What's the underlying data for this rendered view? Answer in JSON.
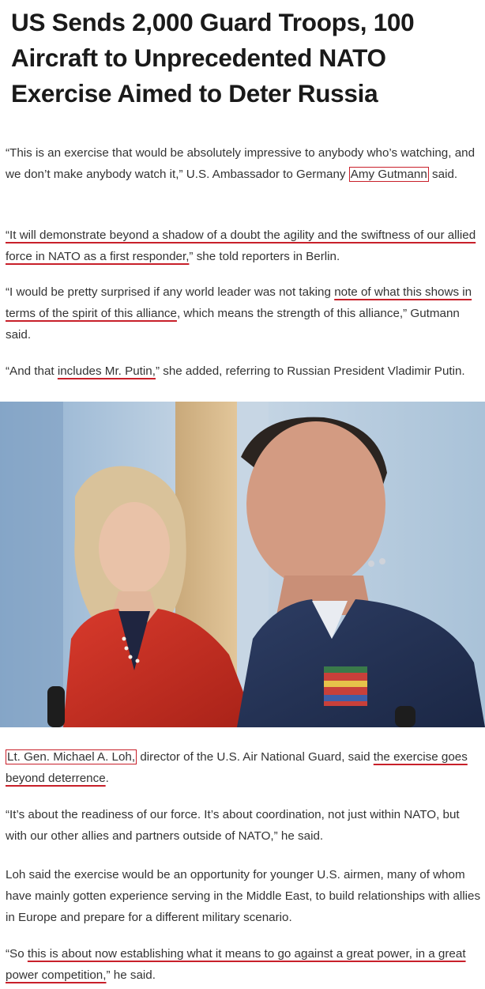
{
  "headline": "US Sends 2,000 Guard Troops, 100 Aircraft to Unprecedented NATO Exercise Aimed to Deter Russia",
  "p1": {
    "before": "“This is an exercise that would be absolutely impressive to anybody who’s watching, and we don’t make anybody watch it,” U.S. Ambassador to Germany ",
    "name": "Amy Gutmann",
    "after": " said."
  },
  "p2": {
    "underlined": "“It will demonstrate beyond a shadow of a doubt the agility and the swiftness of our allied force in NATO as a first responder,",
    "after": "” she told reporters in Berlin."
  },
  "p3": {
    "before": "“I would be pretty surprised if any world leader was not taking ",
    "underlined": "note of what this shows in terms of the spirit of this alliance",
    "after": ", which means the strength of this alliance,” Gutmann said."
  },
  "p4": {
    "before": "“And that ",
    "underlined": "includes Mr. Putin,",
    "after": "” she added, referring to Russian President Vladimir Putin."
  },
  "p5": {
    "name": "Lt. Gen. Michael A. Loh,",
    "middle": " director of the U.S. Air National Guard, said ",
    "underlined": "the exercise goes beyond deterrence",
    "after": "."
  },
  "p6": "“It’s about the readiness of our force. It’s about coordination, not just within NATO, but with our other allies and partners outside of NATO,” he said.",
  "p7": "Loh said the exercise would be an opportunity for younger U.S. airmen, many of whom have mainly gotten experience serving in the Middle East, to build relationships with allies in Europe and prepare for a different military scenario.",
  "p8": {
    "before": "“So ",
    "underlined": "this is about now establishing what it means to go against a great power, in a great power competition,",
    "after": "” he said."
  },
  "colors": {
    "annotation_red": "#c8202a",
    "text": "#333333"
  }
}
